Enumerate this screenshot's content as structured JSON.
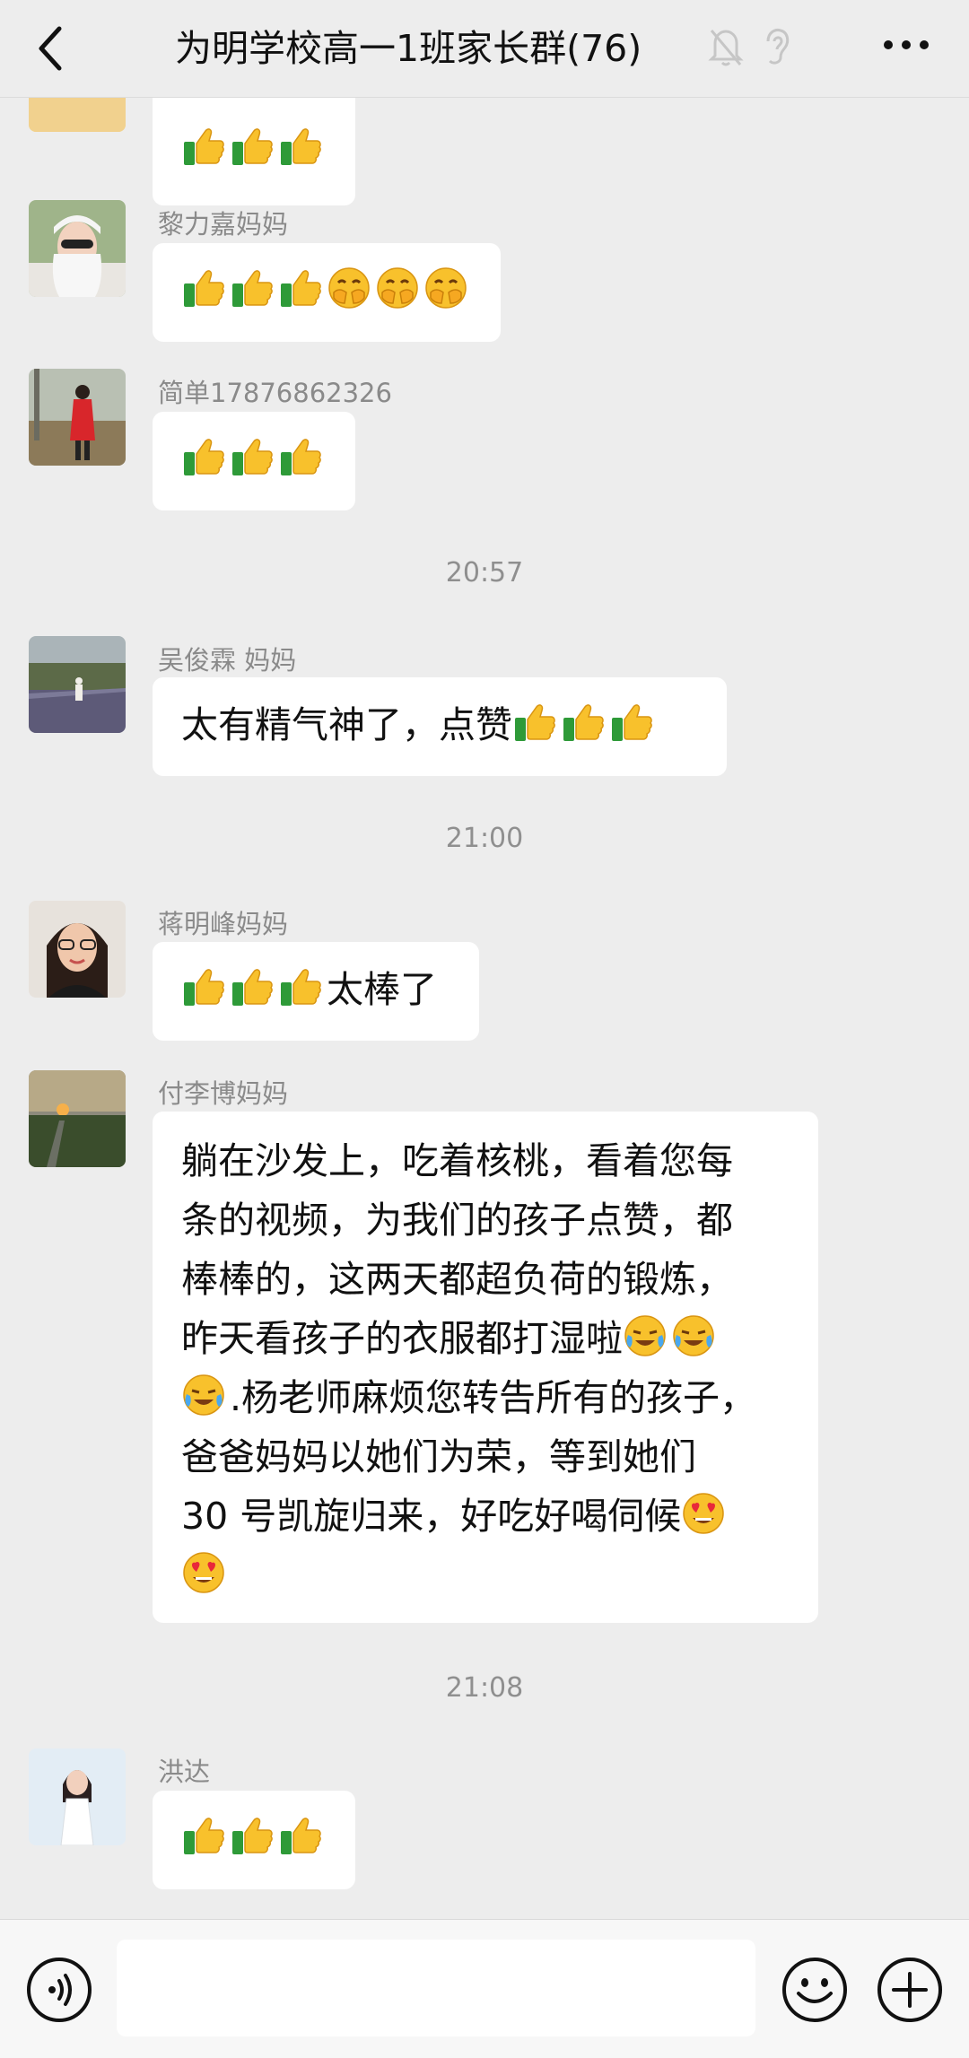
{
  "header": {
    "title": "为明学校高一1班家长群(76)",
    "back_icon": "chevron-left-icon",
    "mute_icon": "bell-off-icon",
    "ear_icon": "ear-icon",
    "more_icon": "more-dots-icon"
  },
  "messages": [
    {
      "sender": "",
      "text": "",
      "emojis": [
        "thumbs-up",
        "thumbs-up",
        "thumbs-up"
      ]
    },
    {
      "sender": "黎力嘉妈妈",
      "text": "",
      "emojis": [
        "thumbs-up",
        "thumbs-up",
        "thumbs-up",
        "grimace",
        "grimace",
        "grimace"
      ]
    },
    {
      "sender": "简单17876862326",
      "text": "",
      "emojis": [
        "thumbs-up",
        "thumbs-up",
        "thumbs-up"
      ]
    },
    {
      "time": "20:57"
    },
    {
      "sender": "吴俊霖 妈妈",
      "text": "太有精气神了，点赞",
      "emojis": [
        "thumbs-up",
        "thumbs-up",
        "thumbs-up"
      ]
    },
    {
      "time": "21:00"
    },
    {
      "sender": "蒋明峰妈妈",
      "text": "太棒了",
      "emojis": [
        "thumbs-up",
        "thumbs-up",
        "thumbs-up"
      ]
    },
    {
      "sender": "付李博妈妈",
      "lines": [
        "躺在沙发上，吃着核桃，看着您每",
        "条的视频，为我们的孩子点赞，都",
        "棒棒的，这两天都超负荷的锻炼，",
        "昨天看孩子的衣服都打湿啦",
        ".杨老师麻烦您转告所有的孩子，",
        "爸爸妈妈以她们为荣，等到她们",
        "30 号凯旋归来，好吃好喝伺候",
        ""
      ]
    },
    {
      "time": "21:08"
    },
    {
      "sender": "洪达",
      "text": "",
      "emojis": [
        "thumbs-up",
        "thumbs-up",
        "thumbs-up"
      ]
    }
  ],
  "input": {
    "voice_icon": "voice-icon",
    "emoji_icon": "smile-icon",
    "plus_icon": "plus-icon",
    "value": ""
  },
  "colors": {
    "background": "#ededed",
    "bubble": "#ffffff",
    "meta_text": "#8a8a8a"
  }
}
